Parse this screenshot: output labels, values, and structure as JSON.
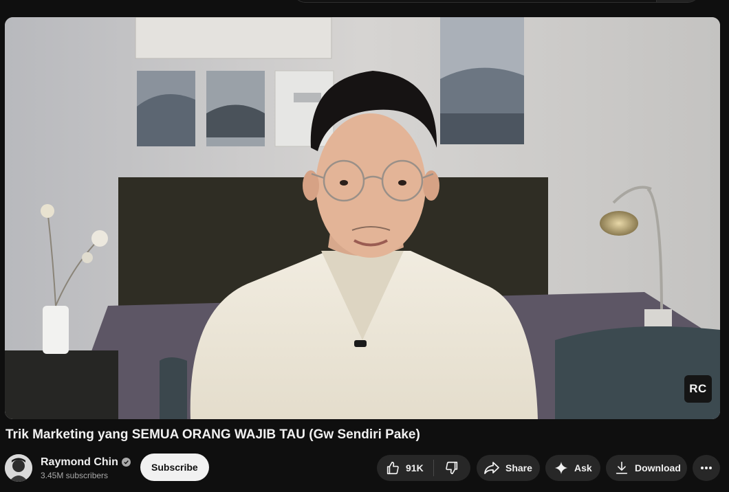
{
  "video": {
    "title": "Trik Marketing yang SEMUA ORANG WAJIB TAU (Gw Sendiri Pake)",
    "watermark": "RC"
  },
  "channel": {
    "name": "Raymond Chin",
    "subscribers": "3.45M subscribers",
    "verified_icon": "check-circle-icon",
    "subscribe_label": "Subscribe"
  },
  "actions": {
    "like_count": "91K",
    "share_label": "Share",
    "ask_label": "Ask",
    "download_label": "Download"
  },
  "colors": {
    "background": "#0f0f0f",
    "pill": "#272727",
    "subscribe_bg": "#f1f1f1",
    "text_primary": "#f1f1f1",
    "text_secondary": "#aaaaaa"
  }
}
